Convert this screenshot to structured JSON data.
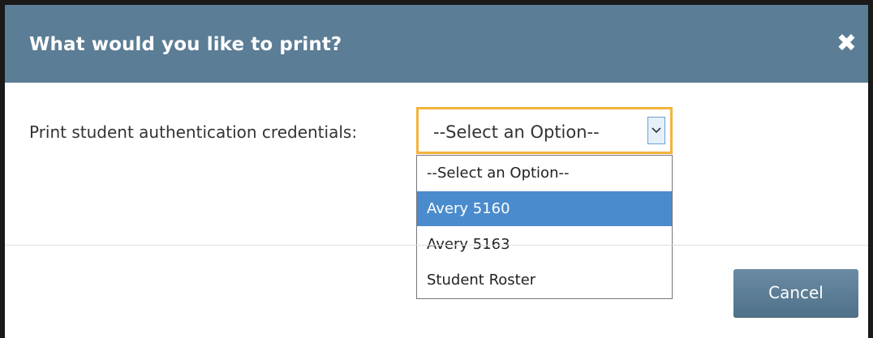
{
  "dialog": {
    "title": "What would you like to print?",
    "close_glyph": "✖"
  },
  "form": {
    "label": "Print student authentication credentials:",
    "select": {
      "value": "--Select an Option--"
    },
    "options": [
      "--Select an Option--",
      "Avery 5160",
      "Avery 5163",
      "Student Roster"
    ],
    "highlighted_option": "Avery 5160"
  },
  "footer": {
    "cancel_label": "Cancel"
  },
  "colors": {
    "header": "#5b7d95",
    "focus_border": "#f3b33b",
    "highlight": "#4a8bcd",
    "button": "#5e7f97"
  }
}
